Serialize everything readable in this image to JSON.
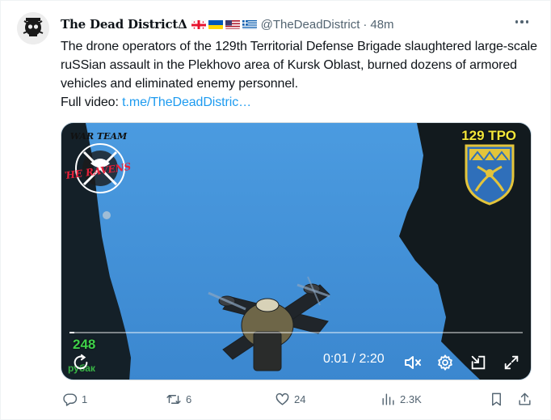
{
  "tweet": {
    "display_name": "The Dead DistrictΔ",
    "flags": [
      "georgia-flag",
      "ukraine-flag",
      "usa-flag",
      "greece-flag"
    ],
    "handle": "@TheDeadDistrict",
    "separator": "·",
    "time": "48m",
    "body": "The drone operators of the 129th Territorial Defense Brigade slaughtered large-scale ruSSian assault in the Plekhovo area of Kursk Oblast, burned dozens of armored vehicles and eliminated enemy personnel.",
    "full_video_label": "Full video: ",
    "full_video_link": "t.me/TheDeadDistric…"
  },
  "video": {
    "overlay_badge": "129 ТРО",
    "logo_text_top": "WAR TEAM",
    "logo_text_mid": "THE RAVENS",
    "watermark_number": "248",
    "watermark_text": "рубак",
    "timecode": "0:01 / 2:20",
    "progress": 0.007
  },
  "actions": {
    "reply_count": "1",
    "retweet_count": "6",
    "like_count": "24",
    "views_count": "2.3K"
  },
  "colors": {
    "accent": "#1d9bf0",
    "muted": "#536471",
    "text": "#0f1419",
    "sky": "#3f90d8",
    "watermark_green": "#3fd04a",
    "badge_yellow": "#f2e63a"
  }
}
